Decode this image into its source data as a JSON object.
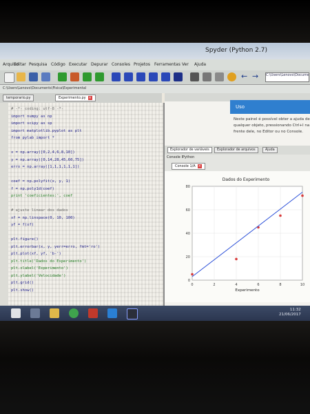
{
  "window": {
    "title": "Spyder (Python 2.7)"
  },
  "menu": [
    "Arquivo",
    "Editar",
    "Pesquisa",
    "Código",
    "Executar",
    "Depurar",
    "Consoles",
    "Projetos",
    "Ferramentas",
    "Ver",
    "Ajuda"
  ],
  "toolbar": {
    "path_value": "C:\\Users\\Lenovo\\Documents"
  },
  "path_row": {
    "text": "C:\\Users\\Lenovo\\Documents\\Fisica\\Experimental"
  },
  "editor": {
    "tabs": [
      {
        "label": "temporario.py"
      },
      {
        "label": "Experimento.py"
      }
    ],
    "lines": [
      {
        "t": "# -*- coding: utf-8 -*-",
        "k": "c"
      },
      {
        "t": "import numpy as np",
        "k": ""
      },
      {
        "t": "import scipy as sp",
        "k": ""
      },
      {
        "t": "import matplotlib.pyplot as plt",
        "k": ""
      },
      {
        "t": "from pylab import *",
        "k": ""
      },
      {
        "t": "",
        "k": ""
      },
      {
        "t": "x = np.array([0,2,4,6,8,10])",
        "k": ""
      },
      {
        "t": "y = np.array([0,14,28,45,60,75])",
        "k": ""
      },
      {
        "t": "erro = np.array([1,1,1,1,1,1])",
        "k": ""
      },
      {
        "t": "",
        "k": ""
      },
      {
        "t": "coef = np.polyfit(x, y, 1)",
        "k": ""
      },
      {
        "t": "f = np.poly1d(coef)",
        "k": ""
      },
      {
        "t": "print 'coeficientes:', coef",
        "k": "s"
      },
      {
        "t": "",
        "k": ""
      },
      {
        "t": "# ajuste linear dos dados",
        "k": "c"
      },
      {
        "t": "xf = np.linspace(0, 10, 100)",
        "k": ""
      },
      {
        "t": "yf = f(xf)",
        "k": ""
      },
      {
        "t": "",
        "k": ""
      },
      {
        "t": "plt.figure()",
        "k": ""
      },
      {
        "t": "plt.errorbar(x, y, yerr=erro, fmt='ro')",
        "k": ""
      },
      {
        "t": "plt.plot(xf, yf, 'b-')",
        "k": ""
      },
      {
        "t": "plt.title('Dados do Experimento')",
        "k": "s"
      },
      {
        "t": "plt.xlabel('Experimento')",
        "k": "s"
      },
      {
        "t": "plt.ylabel('Velocidade')",
        "k": "s"
      },
      {
        "t": "plt.grid()",
        "k": ""
      },
      {
        "t": "plt.show()",
        "k": ""
      }
    ]
  },
  "help": {
    "banner": "Uso",
    "text": "Neste painel é possível obter a ajuda de qualquer objeto, pressionando Ctrl+I na frente dele, no Editor ou no Console."
  },
  "panes": {
    "tabs": [
      "Explorador de variáveis",
      "Explorador de arquivos",
      "Ajuda"
    ]
  },
  "console": {
    "label": "Console IPython",
    "tab": "Console 1/A"
  },
  "chart_data": {
    "type": "scatter",
    "title": "Dados do Experimento",
    "xlabel": "Experimento",
    "ylabel": "",
    "xlim": [
      0,
      10
    ],
    "ylim": [
      0,
      80
    ],
    "xticks": [
      0,
      2,
      4,
      6,
      8,
      10
    ],
    "yticks": [
      0,
      20,
      40,
      60,
      80
    ],
    "series": [
      {
        "kind": "points",
        "color": "#d83a3a",
        "x": [
          0,
          4,
          6,
          8,
          10
        ],
        "y": [
          5,
          18,
          45,
          55,
          72
        ]
      },
      {
        "kind": "fit",
        "color": "#2a4fd8",
        "x": [
          0,
          10
        ],
        "y": [
          3,
          75
        ]
      }
    ]
  },
  "taskbar": {
    "time": "11:32",
    "date": "21/06/2017"
  },
  "colors": {
    "accent": "#2f7fcf",
    "points": "#d83a3a",
    "fit": "#2a4fd8"
  }
}
